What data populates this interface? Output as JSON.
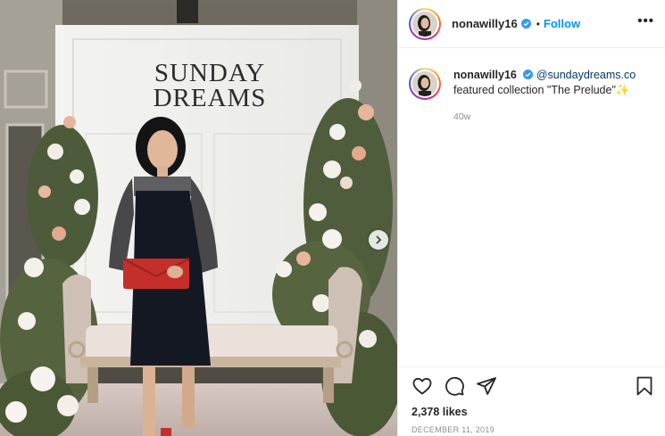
{
  "post": {
    "username": "nonawilly16",
    "follow_label": "Follow",
    "separator": "•",
    "more_label": "•••",
    "caption": {
      "username": "nonawilly16",
      "mention": "@sundaydreams.co",
      "text": "featured collection \"The Prelude\"✨",
      "age": "40w"
    },
    "likes": "2,378 likes",
    "date": "DECEMBER 11, 2019"
  },
  "photo": {
    "backdrop_line1": "SUNDAY",
    "backdrop_line2": "DREAMS"
  },
  "icons": {
    "like": "heart-icon",
    "comment": "comment-icon",
    "share": "share-icon",
    "save": "bookmark-icon",
    "verified": "verified-badge-icon",
    "next": "chevron-right-icon"
  },
  "colors": {
    "link": "#0095f6",
    "mention": "#00376b",
    "muted": "#8e8e8e",
    "verified": "#3897f0"
  }
}
